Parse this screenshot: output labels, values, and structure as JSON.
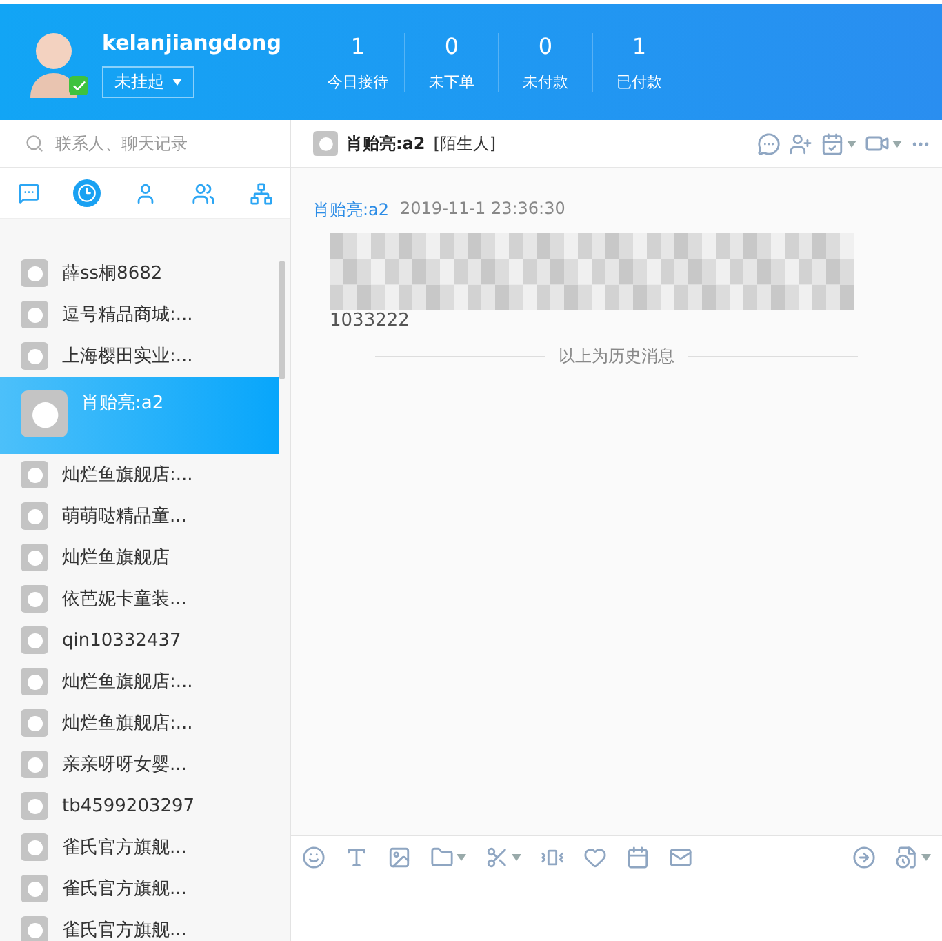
{
  "header": {
    "username": "kelanjiangdong",
    "status": "未挂起",
    "online": true,
    "stats": [
      {
        "value": "1",
        "label": "今日接待"
      },
      {
        "value": "0",
        "label": "未下单"
      },
      {
        "value": "0",
        "label": "未付款"
      },
      {
        "value": "1",
        "label": "已付款"
      }
    ]
  },
  "sidebar": {
    "search": {
      "placeholder": "联系人、聊天记录"
    },
    "tabs": [
      {
        "kind": "chat",
        "selected": false
      },
      {
        "kind": "recent",
        "selected": true
      },
      {
        "kind": "contact",
        "selected": false
      },
      {
        "kind": "group",
        "selected": false
      },
      {
        "kind": "org",
        "selected": false
      }
    ],
    "contacts": [
      {
        "name": "薛ss桐8682",
        "selected": false
      },
      {
        "name": "逗号精品商城:...",
        "selected": false
      },
      {
        "name": "上海樱田实业:...",
        "selected": false
      },
      {
        "name": "肖贻亮:a2",
        "selected": true
      },
      {
        "name": "灿烂鱼旗舰店:...",
        "selected": false
      },
      {
        "name": "萌萌哒精品童...",
        "selected": false
      },
      {
        "name": "灿烂鱼旗舰店",
        "selected": false
      },
      {
        "name": "依芭妮卡童装...",
        "selected": false
      },
      {
        "name": "qin10332437",
        "selected": false
      },
      {
        "name": "灿烂鱼旗舰店:...",
        "selected": false
      },
      {
        "name": "灿烂鱼旗舰店:...",
        "selected": false
      },
      {
        "name": "亲亲呀呀女婴...",
        "selected": false
      },
      {
        "name": "tb4599203297",
        "selected": false
      },
      {
        "name": "雀氏官方旗舰...",
        "selected": false
      },
      {
        "name": "雀氏官方旗舰...",
        "selected": false
      },
      {
        "name": "雀氏官方旗舰...",
        "selected": false
      }
    ]
  },
  "chat": {
    "title": "肖贻亮:a2",
    "tag": "[陌生人]",
    "messages": [
      {
        "sender": "肖贻亮:a2",
        "time": "2019-11-1 23:36:30",
        "text_tail": "1033222"
      }
    ],
    "history_divider": "以上为历史消息"
  }
}
